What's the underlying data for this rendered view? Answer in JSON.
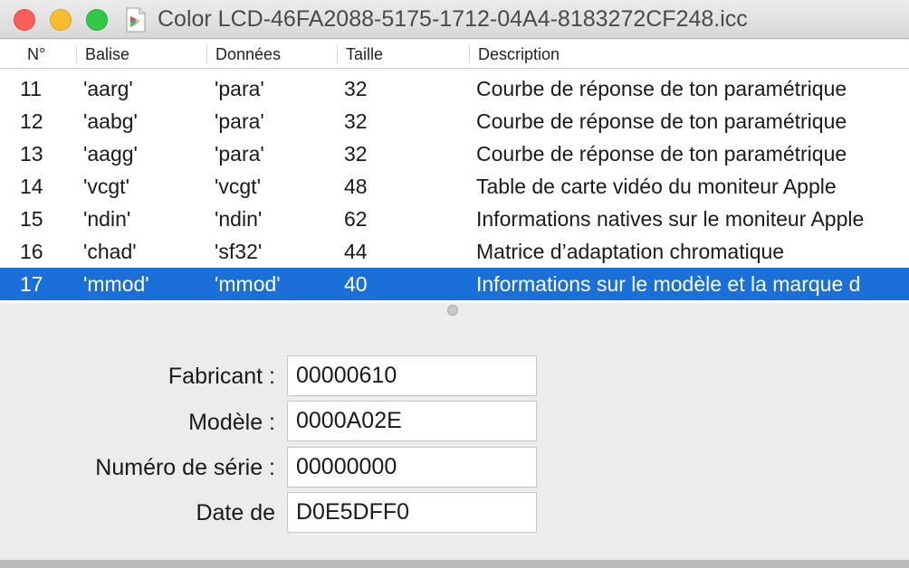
{
  "window": {
    "title": "Color LCD-46FA2088-5175-1712-04A4-8183272CF248.icc"
  },
  "table": {
    "columns": [
      "N°",
      "Balise",
      "Données",
      "Taille",
      "Description"
    ],
    "rows": [
      {
        "no": "11",
        "tag": "'aarg'",
        "data": "'para'",
        "size": "32",
        "desc": "Courbe de réponse de ton paramétrique"
      },
      {
        "no": "12",
        "tag": "'aabg'",
        "data": "'para'",
        "size": "32",
        "desc": "Courbe de réponse de ton paramétrique"
      },
      {
        "no": "13",
        "tag": "'aagg'",
        "data": "'para'",
        "size": "32",
        "desc": "Courbe de réponse de ton paramétrique"
      },
      {
        "no": "14",
        "tag": "'vcgt'",
        "data": "'vcgt'",
        "size": "48",
        "desc": "Table de carte vidéo du moniteur Apple"
      },
      {
        "no": "15",
        "tag": "'ndin'",
        "data": "'ndin'",
        "size": "62",
        "desc": "Informations natives sur le moniteur Apple"
      },
      {
        "no": "16",
        "tag": "'chad'",
        "data": "'sf32'",
        "size": "44",
        "desc": "Matrice d’adaptation chromatique"
      },
      {
        "no": "17",
        "tag": "'mmod'",
        "data": "'mmod'",
        "size": "40",
        "desc": "Informations sur le modèle et la marque d"
      }
    ],
    "selected_row": "17"
  },
  "details": {
    "fields": [
      {
        "label": "Fabricant :",
        "value": "00000610"
      },
      {
        "label": "Modèle :",
        "value": "0000A02E"
      },
      {
        "label": "Numéro de série :",
        "value": "00000000"
      },
      {
        "label": "Date de",
        "value": "D0E5DFF0"
      }
    ]
  },
  "colors": {
    "selection": "#1b6fd8",
    "close": "#fc5f57",
    "minimize": "#fdbc2e",
    "zoom": "#34c84a"
  },
  "icons": {
    "document": "colorsync-profile-icon"
  }
}
